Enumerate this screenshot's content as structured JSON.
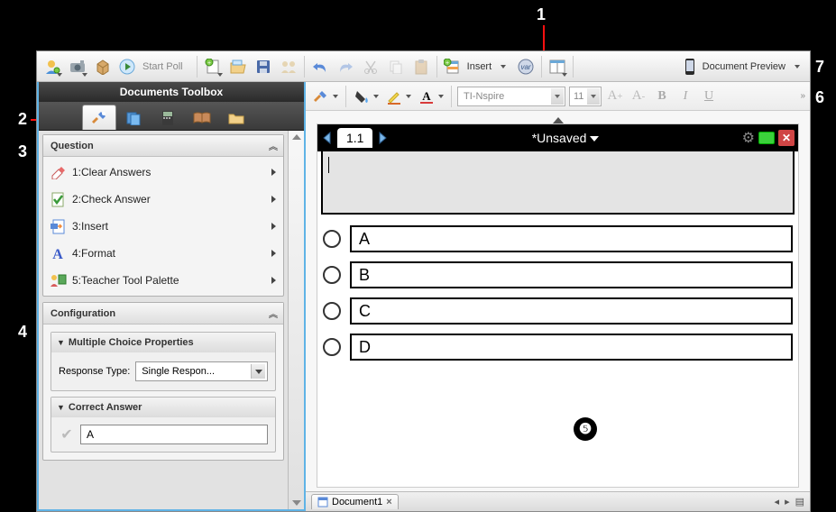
{
  "callouts": {
    "c1": "1",
    "c2": "2",
    "c3": "3",
    "c4": "4",
    "c5": "❺",
    "c6": "6",
    "c7": "7"
  },
  "toolbar": {
    "start_poll": "Start Poll",
    "insert": "Insert",
    "doc_preview": "Document Preview"
  },
  "toolbox": {
    "title": "Documents Toolbox",
    "question_header": "Question",
    "items": [
      {
        "label": "1:Clear Answers"
      },
      {
        "label": "2:Check Answer"
      },
      {
        "label": "3:Insert"
      },
      {
        "label": "4:Format"
      },
      {
        "label": "5:Teacher Tool Palette"
      }
    ],
    "config_header": "Configuration",
    "mc_props": "Multiple Choice Properties",
    "response_type_label": "Response Type:",
    "response_type_value": "Single Respon...",
    "correct_answer": "Correct Answer",
    "correct_value": "A"
  },
  "format_bar": {
    "font": "TI-Nspire",
    "size": "11",
    "bigA": "A",
    "smallA": "A",
    "B": "B",
    "I": "I",
    "U": "U"
  },
  "document": {
    "page_tab": "1.1",
    "title": "*Unsaved",
    "choices": [
      "A",
      "B",
      "C",
      "D"
    ]
  },
  "tabstrip": {
    "name": "Document1"
  }
}
